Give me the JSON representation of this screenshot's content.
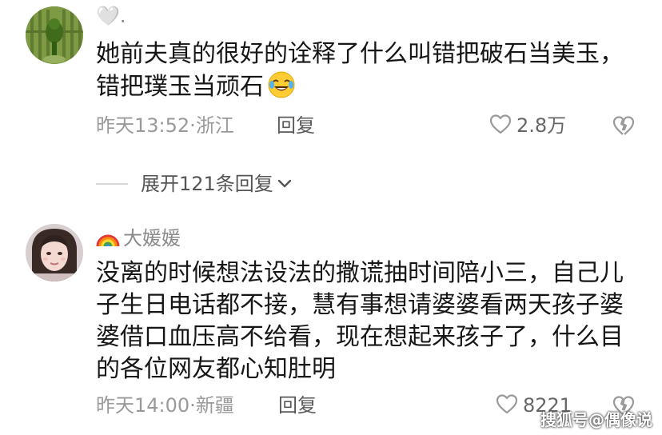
{
  "comments": [
    {
      "username": "🤍.",
      "text_lines": [
        "她前夫真的很好的诠释了什么叫错把破石当美玉，",
        "错把璞玉当顽石"
      ],
      "inline_emoji": "laughing-crying-emoji",
      "time": "昨天13:52",
      "location": "浙江",
      "reply_label": "回复",
      "like_count": "2.8万"
    },
    {
      "username_prefix": "🌈",
      "username": "大媛媛",
      "text_lines": [
        "没离的时候想法设法的撒谎抽时间陪小三，自己儿",
        "子生日电话都不接，慧有事想请婆婆看两天孩子婆",
        "婆借口血压高不给看，现在想起来孩子了，什么目",
        "的各位网友都心知肚明"
      ],
      "time": "昨天14:00",
      "location": "新疆",
      "reply_label": "回复",
      "like_count": "8221"
    }
  ],
  "expand_replies": {
    "label": "展开121条回复"
  },
  "meta_separator": "·",
  "watermark": "搜狐号@偶像说",
  "icons": {
    "like": "heart-outline-icon",
    "dislike": "broken-heart-outline-icon",
    "expand": "chevron-down-icon"
  },
  "colors": {
    "text_primary": "#161616",
    "text_secondary": "#9a9a9a",
    "icon_gray": "#9a9a9a"
  }
}
